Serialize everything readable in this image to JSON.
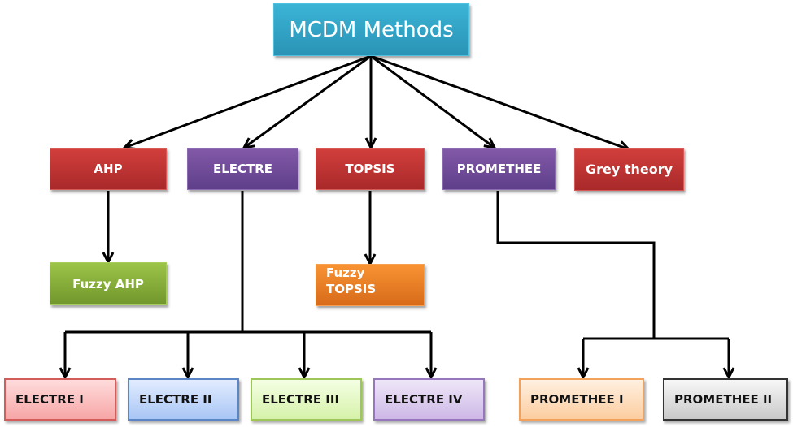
{
  "diagram": {
    "root": {
      "label": "MCDM Methods"
    },
    "methods": [
      {
        "label": "AHP",
        "color": "#c0393a"
      },
      {
        "label": "ELECTRE",
        "color": "#704d9a"
      },
      {
        "label": "TOPSIS",
        "color": "#c0393a"
      },
      {
        "label": "PROMETHEE",
        "color": "#704d9a"
      },
      {
        "label": "Grey theory",
        "color": "#c0393a"
      }
    ],
    "variants": {
      "fuzzy_ahp": {
        "label": "Fuzzy AHP",
        "parent": "AHP",
        "color": "#86ad3a"
      },
      "fuzzy_topsis": {
        "label_line1": "Fuzzy",
        "label_line2": "TOPSIS",
        "parent": "TOPSIS",
        "color": "#f0812a"
      },
      "electre": [
        {
          "label": "ELECTRE I",
          "color": "#f7a6a6"
        },
        {
          "label": "ELECTRE II",
          "color": "#a9c6f5"
        },
        {
          "label": "ELECTRE III",
          "color": "#d6f2aa"
        },
        {
          "label": "ELECTRE IV",
          "color": "#cdb8e6"
        }
      ],
      "promethee": [
        {
          "label": "PROMETHEE I",
          "color": "#fccda0"
        },
        {
          "label": "PROMETHEE II",
          "color": "#c9c9c9"
        }
      ]
    },
    "edges": [
      [
        "MCDM Methods",
        "AHP"
      ],
      [
        "MCDM Methods",
        "ELECTRE"
      ],
      [
        "MCDM Methods",
        "TOPSIS"
      ],
      [
        "MCDM Methods",
        "PROMETHEE"
      ],
      [
        "MCDM Methods",
        "Grey theory"
      ],
      [
        "AHP",
        "Fuzzy AHP"
      ],
      [
        "TOPSIS",
        "Fuzzy TOPSIS"
      ],
      [
        "ELECTRE",
        "ELECTRE I"
      ],
      [
        "ELECTRE",
        "ELECTRE II"
      ],
      [
        "ELECTRE",
        "ELECTRE III"
      ],
      [
        "ELECTRE",
        "ELECTRE IV"
      ],
      [
        "PROMETHEE",
        "PROMETHEE I"
      ],
      [
        "PROMETHEE",
        "PROMETHEE II"
      ]
    ]
  }
}
